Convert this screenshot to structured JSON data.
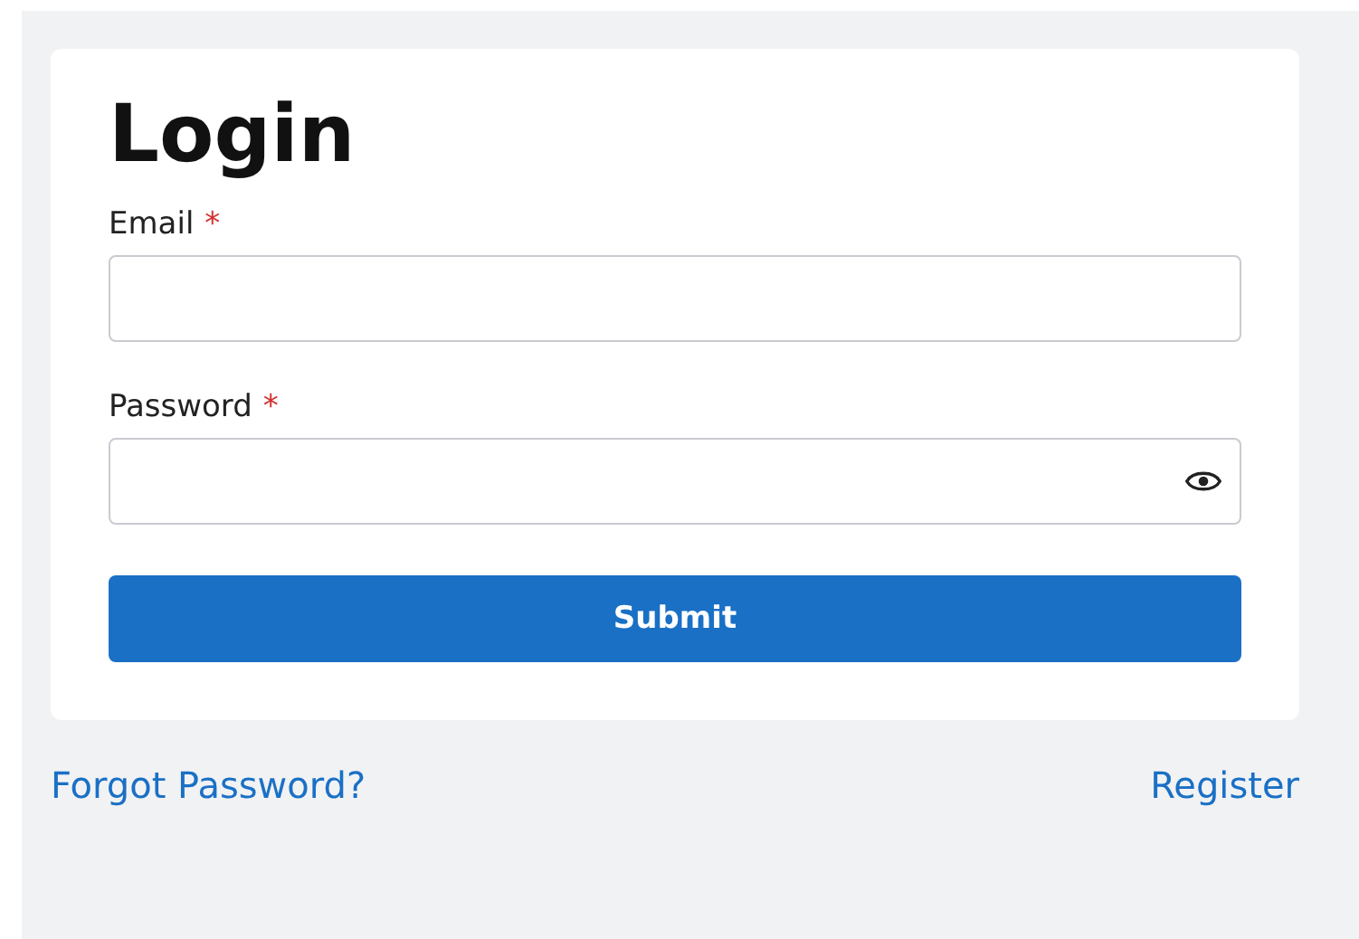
{
  "title": "Login",
  "fields": [
    {
      "kind": "email",
      "label": "Email",
      "required_mark": "*"
    },
    {
      "kind": "password",
      "label": "Password",
      "required_mark": "*"
    }
  ],
  "submit": {
    "label": "Submit"
  },
  "links": [
    {
      "label": "Forgot Password?"
    },
    {
      "label": "Register"
    }
  ]
}
